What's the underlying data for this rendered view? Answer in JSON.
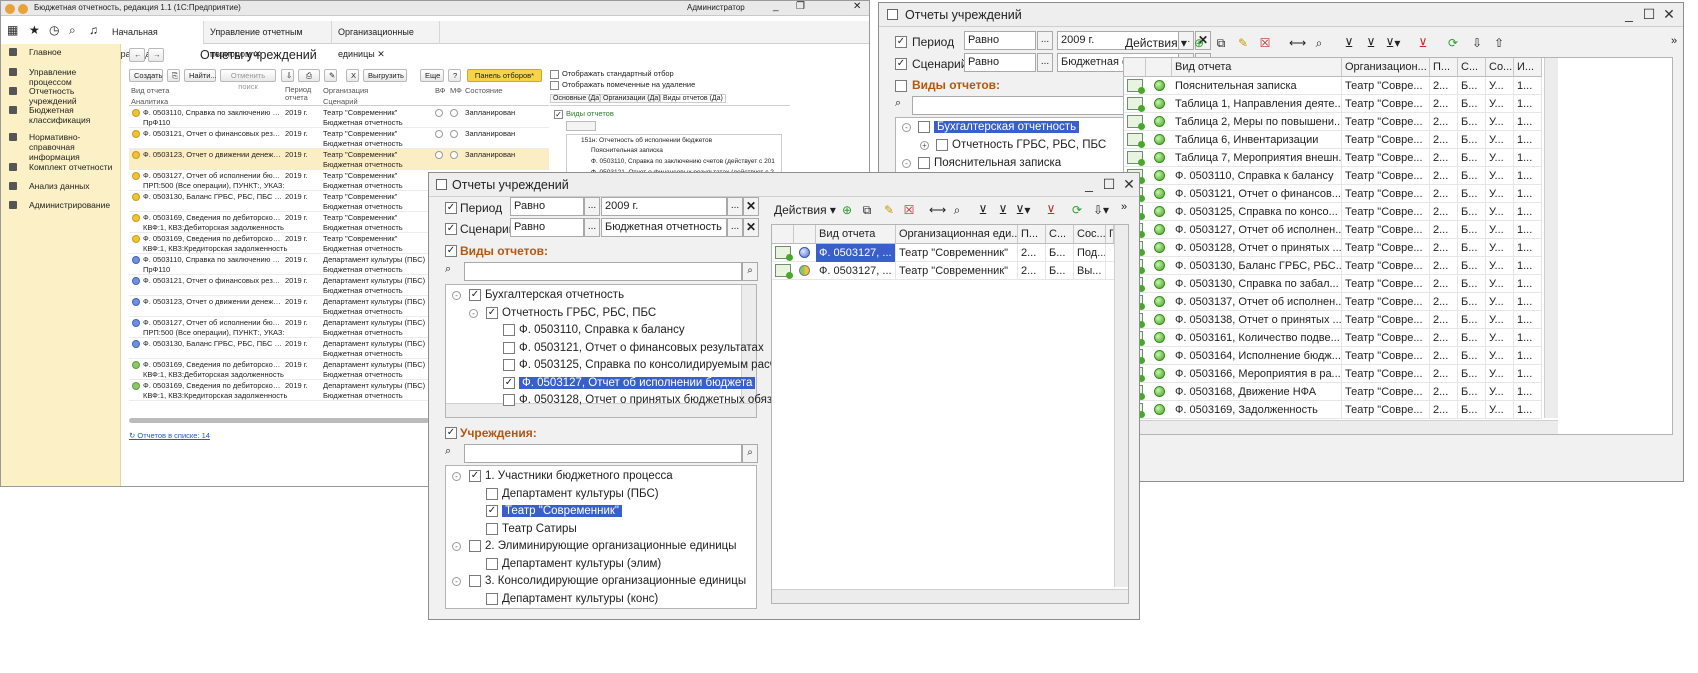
{
  "w1": {
    "title": "Бюджетная отчетность, редакция 1.1 (1С:Предприятие)",
    "user": "Администратор",
    "tabs": [
      "Начальная страница",
      "Управление отчетным периодом",
      "Организационные единицы"
    ],
    "sidebar": [
      "Главное",
      "Управление процессом",
      "Отчетность учреждений",
      "Бюджетная классификация",
      "Нормативно-справочная информация",
      "Комплект отчетности",
      "Анализ данных",
      "Администрирование"
    ],
    "page_title": "Отчеты учреждений",
    "buttons": {
      "create": "Создать",
      "find": "Найти...",
      "cancel_search": "Отменить поиск",
      "export": "Выгрузить",
      "more": "Еще",
      "help": "?",
      "filter_panel": "Панель отборов*"
    },
    "headers": {
      "vid": "Вид отчета",
      "analitika": "Аналитика",
      "period": "Период отчета",
      "org": "Организация",
      "scenario": "Сценарий",
      "vf": "ВФ",
      "mf": "МФ",
      "state": "Состояние"
    },
    "rows": [
      {
        "dot": "y",
        "l1": "Ф. 0503110, Справка по заключению счетов (д...",
        "l2": "ПрФ110",
        "period": "2019 г.",
        "org": "Театр \"Современник\"",
        "scen": "Бюджетная отчетность",
        "state": "Запланирован",
        "radios": true
      },
      {
        "dot": "y",
        "l1": "Ф. 0503121, Отчет о финансовых результатах ...",
        "l2": "",
        "period": "2019 г.",
        "org": "Театр \"Современник\"",
        "scen": "Бюджетная отчетность",
        "state": "Запланирован",
        "radios": true
      },
      {
        "dot": "y",
        "l1": "Ф. 0503123, Отчет о движении денежных сред...",
        "l2": "",
        "period": "2019 г.",
        "org": "Театр \"Современник\"",
        "scen": "Бюджетная отчетность",
        "state": "Запланирован",
        "radios": true,
        "sel": true
      },
      {
        "dot": "y",
        "l1": "Ф. 0503127, Отчет об исполнении бюджета (д...",
        "l2": "ПРП:500 (Все операции), ПУНКТ:, УКАЗ:",
        "period": "2019 г.",
        "org": "Театр \"Современник\"",
        "scen": "Бюджетная отчетность",
        "state": "",
        "radios": false
      },
      {
        "dot": "y",
        "l1": "Ф. 0503130, Баланс ГРБС, РБС, ПБС (действ...",
        "l2": "",
        "period": "2019 г.",
        "org": "Театр \"Современник\"",
        "scen": "Бюджетная отчетность",
        "state": "",
        "radios": false
      },
      {
        "dot": "y",
        "l1": "Ф. 0503169, Сведения по дебиторской и креди...",
        "l2": "КВФ:1, КВЗ:Дебиторская задолженность",
        "period": "2019 г.",
        "org": "Театр \"Современник\"",
        "scen": "Бюджетная отчетность",
        "state": "",
        "radios": false
      },
      {
        "dot": "y",
        "l1": "Ф. 0503169, Сведения по дебиторской и креди...",
        "l2": "КВФ:1, КВЗ:Кредиторская задолженность",
        "period": "2019 г.",
        "org": "Театр \"Современник\"",
        "scen": "Бюджетная отчетность",
        "state": "",
        "radios": false
      },
      {
        "dot": "b",
        "l1": "Ф. 0503110, Справка по заключению счетов (д...",
        "l2": "ПрФ110",
        "period": "2019 г.",
        "org": "Департамент культуры (ПБС)",
        "scen": "Бюджетная отчетность",
        "state": "",
        "radios": false
      },
      {
        "dot": "b",
        "l1": "Ф. 0503121, Отчет о финансовых результатах ...",
        "l2": "",
        "period": "2019 г.",
        "org": "Департамент культуры (ПБС)",
        "scen": "Бюджетная отчетность",
        "state": "",
        "radios": false
      },
      {
        "dot": "b",
        "l1": "Ф. 0503123, Отчет о движении денежных сред...",
        "l2": "",
        "period": "2019 г.",
        "org": "Департамент культуры (ПБС)",
        "scen": "Бюджетная отчетность",
        "state": "",
        "radios": false
      },
      {
        "dot": "b",
        "l1": "Ф. 0503127, Отчет об исполнении бюджета (д...",
        "l2": "ПРП:500 (Все операции), ПУНКТ:, УКАЗ:",
        "period": "2019 г.",
        "org": "Департамент культуры (ПБС)",
        "scen": "Бюджетная отчетность",
        "state": "",
        "radios": false
      },
      {
        "dot": "b",
        "l1": "Ф. 0503130, Баланс ГРБС, РБС, ПБС (действуе...",
        "l2": "",
        "period": "2019 г.",
        "org": "Департамент культуры (ПБС)",
        "scen": "Бюджетная отчетность",
        "state": "",
        "radios": false
      },
      {
        "dot": "g",
        "l1": "Ф. 0503169, Сведения по дебиторской и креди...",
        "l2": "КВФ:1, КВЗ:Дебиторская задолженность",
        "period": "2019 г.",
        "org": "Департамент культуры (ПБС)",
        "scen": "Бюджетная отчетность",
        "state": "",
        "radios": false
      },
      {
        "dot": "g",
        "l1": "Ф. 0503169, Сведения по дебиторской и креди...",
        "l2": "КВФ:1, КВЗ:Кредиторская задолженность",
        "period": "2019 г.",
        "org": "Департамент культуры (ПБС)",
        "scen": "Бюджетная отчетность",
        "state": "",
        "radios": false
      }
    ],
    "count_link": "Отчетов в списке: 14",
    "filters": {
      "std": "Отображать стандартный отбор",
      "deleted": "Отображать помеченные на удаление",
      "tabs": [
        "Основные (Да)",
        "Организации (Да)",
        "Виды отчетов (Да)"
      ],
      "tree_root": "Виды отчетов",
      "tree_items": [
        "151н: Отчетность об исполнении бюджетов",
        "Пояснительная записка",
        "Ф. 0503110, Справка по заключению счетов (действует с 201",
        "Ф. 0503121, Отчет о финансовых результатах (действует с 2"
      ]
    }
  },
  "w2": {
    "title": "Отчеты учреждений",
    "period_label": "Период",
    "period_cmp": "Равно",
    "period_val": "2009 г.",
    "scen_label": "Сценарий",
    "scen_cmp": "Равно",
    "scen_val": "Бюджетная отчетност",
    "types_label": "Виды отчетов:",
    "tree": [
      "Бухгалтерская отчетность",
      "Отчетность ГРБС, РБС, ПБС",
      "Пояснительная записка"
    ],
    "actions": "Действия",
    "cols": [
      "Вид отчета",
      "Организацион...",
      "П...",
      "С...",
      "Со...",
      "И..."
    ],
    "rows": [
      {
        "name": "Пояснительная записка",
        "org": "Театр \"Совре...",
        "p": "2...",
        "s": "Б...",
        "c": "У...",
        "i": "1..."
      },
      {
        "name": "Таблица 1, Направления деяте...",
        "org": "Театр \"Совре...",
        "p": "2...",
        "s": "Б...",
        "c": "У...",
        "i": "1..."
      },
      {
        "name": "Таблица 2, Меры по повышени...",
        "org": "Театр \"Совре...",
        "p": "2...",
        "s": "Б...",
        "c": "У...",
        "i": "1..."
      },
      {
        "name": "Таблица 6, Инвентаризации",
        "org": "Театр \"Совре...",
        "p": "2...",
        "s": "Б...",
        "c": "У...",
        "i": "1..."
      },
      {
        "name": "Таблица 7, Мероприятия внешн...",
        "org": "Театр \"Совре...",
        "p": "2...",
        "s": "Б...",
        "c": "У...",
        "i": "1..."
      },
      {
        "name": "Ф. 0503110, Справка к балансу",
        "org": "Театр \"Совре...",
        "p": "2...",
        "s": "Б...",
        "c": "У...",
        "i": "1..."
      },
      {
        "name": "Ф. 0503121, Отчет о финансов...",
        "org": "Театр \"Совре...",
        "p": "2...",
        "s": "Б...",
        "c": "У...",
        "i": "1..."
      },
      {
        "name": "Ф. 0503125, Справка по консо...",
        "org": "Театр \"Совре...",
        "p": "2...",
        "s": "Б...",
        "c": "У...",
        "i": "1..."
      },
      {
        "name": "Ф. 0503127, Отчет об исполнен...",
        "org": "Театр \"Совре...",
        "p": "2...",
        "s": "Б...",
        "c": "У...",
        "i": "1..."
      },
      {
        "name": "Ф. 0503128, Отчет о принятых ...",
        "org": "Театр \"Совре...",
        "p": "2...",
        "s": "Б...",
        "c": "У...",
        "i": "1..."
      },
      {
        "name": "Ф. 0503130, Баланс ГРБС, РБС...",
        "org": "Театр \"Совре...",
        "p": "2...",
        "s": "Б...",
        "c": "У...",
        "i": "1..."
      },
      {
        "name": "Ф. 0503130, Справка по забал...",
        "org": "Театр \"Совре...",
        "p": "2...",
        "s": "Б...",
        "c": "У...",
        "i": "1..."
      },
      {
        "name": "Ф. 0503137, Отчет об исполнен...",
        "org": "Театр \"Совре...",
        "p": "2...",
        "s": "Б...",
        "c": "У...",
        "i": "1..."
      },
      {
        "name": "Ф. 0503138, Отчет о принятых ...",
        "org": "Театр \"Совре...",
        "p": "2...",
        "s": "Б...",
        "c": "У...",
        "i": "1..."
      },
      {
        "name": "Ф. 0503161, Количество подве...",
        "org": "Театр \"Совре...",
        "p": "2...",
        "s": "Б...",
        "c": "У...",
        "i": "1..."
      },
      {
        "name": "Ф. 0503164, Исполнение бюдж...",
        "org": "Театр \"Совре...",
        "p": "2...",
        "s": "Б...",
        "c": "У...",
        "i": "1..."
      },
      {
        "name": "Ф. 0503166, Мероприятия в ра...",
        "org": "Театр \"Совре...",
        "p": "2...",
        "s": "Б...",
        "c": "У...",
        "i": "1..."
      },
      {
        "name": "Ф. 0503168, Движение НФА",
        "org": "Театр \"Совре...",
        "p": "2...",
        "s": "Б...",
        "c": "У...",
        "i": "1..."
      },
      {
        "name": "Ф. 0503169, Задолженность",
        "org": "Театр \"Совре...",
        "p": "2...",
        "s": "Б...",
        "c": "У...",
        "i": "1..."
      }
    ]
  },
  "w3": {
    "title": "Отчеты учреждений",
    "period_label": "Период",
    "period_cmp": "Равно",
    "period_val": "2009 г.",
    "scen_label": "Сценарий",
    "scen_cmp": "Равно",
    "scen_val": "Бюджетная отчетность",
    "types_label": "Виды отчетов:",
    "types_tree": [
      {
        "text": "Бухгалтерская отчетность",
        "level": 0,
        "toggle": "-",
        "checked": true
      },
      {
        "text": "Отчетность ГРБС, РБС, ПБС",
        "level": 1,
        "toggle": "-",
        "checked": true
      },
      {
        "text": "Ф. 0503110, Справка к балансу",
        "level": 2,
        "toggle": "",
        "checked": false
      },
      {
        "text": "Ф. 0503121, Отчет о финансовых результатах",
        "level": 2,
        "toggle": "",
        "checked": false
      },
      {
        "text": "Ф. 0503125, Справка по консолидируемым расч",
        "level": 2,
        "toggle": "",
        "checked": false
      },
      {
        "text": "Ф. 0503127, Отчет об исполнении бюджета",
        "level": 2,
        "toggle": "",
        "checked": true,
        "hl": true
      },
      {
        "text": "Ф. 0503128, Отчет о принятых бюджетных обяза",
        "level": 2,
        "toggle": "",
        "checked": false
      }
    ],
    "inst_label": "Учреждения:",
    "inst_tree": [
      {
        "text": "1. Участники бюджетного процесса",
        "level": 0,
        "toggle": "-",
        "checked": true
      },
      {
        "text": "Департамент культуры (ПБС)",
        "level": 1,
        "toggle": "",
        "checked": false
      },
      {
        "text": "Театр \"Современник\"",
        "level": 1,
        "toggle": "",
        "checked": true,
        "hl": true
      },
      {
        "text": "Театр Сатиры",
        "level": 1,
        "toggle": "",
        "checked": false
      },
      {
        "text": "2. Элиминирующие организационные единицы",
        "level": 0,
        "toggle": "-",
        "checked": false
      },
      {
        "text": "Департамент культуры (элим)",
        "level": 1,
        "toggle": "",
        "checked": false
      },
      {
        "text": "3. Консолидирующие организационные единицы",
        "level": 0,
        "toggle": "-",
        "checked": false
      },
      {
        "text": "Департамент культуры (конс)",
        "level": 1,
        "toggle": "",
        "checked": false
      }
    ],
    "actions": "Действия",
    "cols": [
      "Вид отчета",
      "Организационная еди...",
      "П...",
      "С...",
      "Сос...",
      "Г"
    ],
    "rows": [
      {
        "name": "Ф. 0503127, ...",
        "org": "Театр \"Современник\"",
        "p": "2...",
        "s": "Б...",
        "c": "Под...",
        "dot": "blue",
        "sel": true
      },
      {
        "name": "Ф. 0503127, ...",
        "org": "Театр \"Современник\"",
        "p": "2...",
        "s": "Б...",
        "c": "Вы...",
        "dot": "multi",
        "sel": false
      }
    ]
  },
  "colors": {
    "sidebar_bg": "#fcf1c6",
    "accent_orange": "#b5570f",
    "selection_blue": "#3a5fcd",
    "filter_btn": "#f5d547"
  }
}
